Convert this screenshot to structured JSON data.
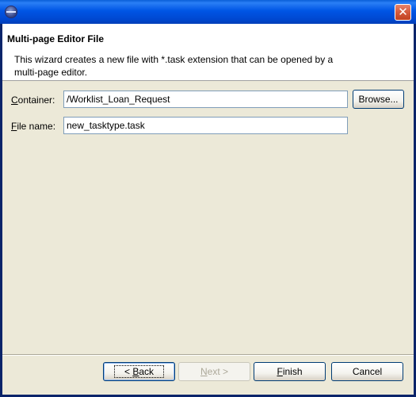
{
  "window": {
    "close_glyph": "✕"
  },
  "header": {
    "title": "Multi-page Editor File",
    "description": "This wizard creates a new file with *.task extension that can be opened by a multi-page editor."
  },
  "form": {
    "container_label_mnemonic": "C",
    "container_label_rest": "ontainer:",
    "container_value": "/Worklist_Loan_Request",
    "browse_label": "Browse...",
    "filename_label_mnemonic": "F",
    "filename_label_rest": "ile name:",
    "filename_value": "new_tasktype.task"
  },
  "footer": {
    "back_prefix": "< ",
    "back_mnemonic": "B",
    "back_rest": "ack",
    "next_mnemonic": "N",
    "next_rest": "ext >",
    "finish_mnemonic": "F",
    "finish_rest": "inish",
    "cancel_label": "Cancel"
  }
}
